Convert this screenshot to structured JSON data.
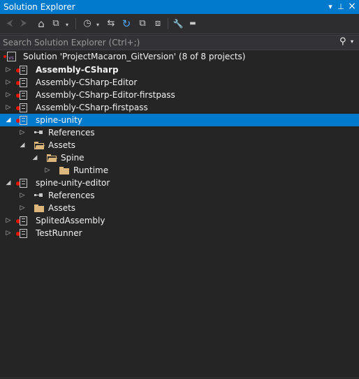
{
  "panel": {
    "title": "Solution Explorer",
    "controls": {
      "dropdown": "▾",
      "pin": "⊥",
      "close": "×"
    }
  },
  "toolbar": {
    "back": "⮜",
    "forward": "⮞",
    "home": "⌂",
    "switch_views": "⧉",
    "pending_changes": "◷",
    "sync": "⇆",
    "refresh": "↻",
    "collapse_all": "⧉",
    "show_all_files": "⧈",
    "properties": "🔧",
    "preview": "▬"
  },
  "search": {
    "placeholder": "Search Solution Explorer (Ctrl+;)",
    "value": ""
  },
  "tree": {
    "solution": "Solution 'ProjectMacaron_GitVersion' (8 of 8 projects)",
    "items": [
      {
        "label": "Assembly-CSharp",
        "bold": true
      },
      {
        "label": "Assembly-CSharp-Editor"
      },
      {
        "label": "Assembly-CSharp-Editor-firstpass"
      },
      {
        "label": "Assembly-CSharp-firstpass"
      },
      {
        "label": "spine-unity",
        "selected": true
      },
      {
        "label": "References"
      },
      {
        "label": "Assets"
      },
      {
        "label": "Spine"
      },
      {
        "label": "Runtime"
      },
      {
        "label": "spine-unity-editor"
      },
      {
        "label": "References"
      },
      {
        "label": "Assets"
      },
      {
        "label": "SplitedAssembly"
      },
      {
        "label": "TestRunner"
      }
    ]
  },
  "colors": {
    "accent": "#007acc",
    "background": "#252526",
    "folder": "#dcb67a",
    "error_dot": "#e51400"
  }
}
